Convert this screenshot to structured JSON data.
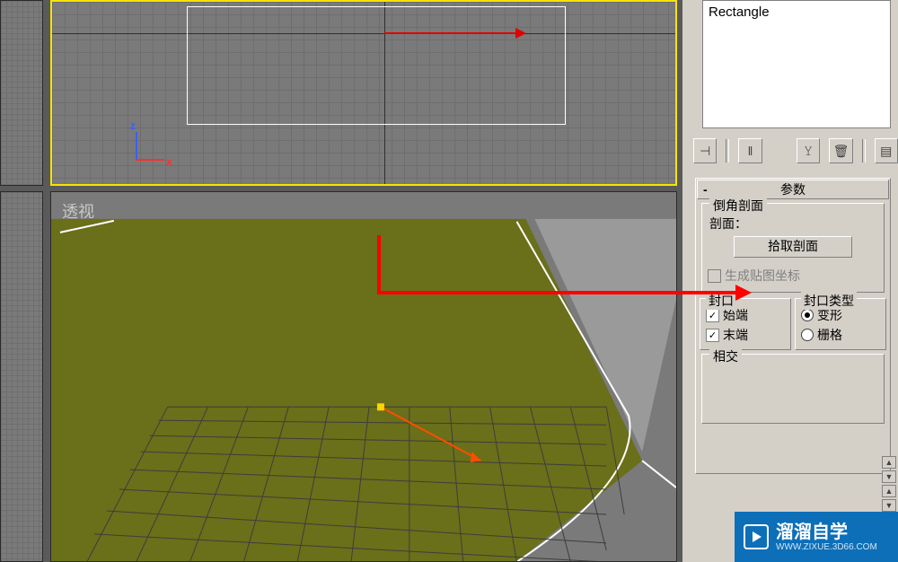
{
  "modifier_stack": {
    "item": "Rectangle"
  },
  "viewport": {
    "perspective_label": "透视",
    "axis_x": "x",
    "axis_z": "z"
  },
  "toolbar": {
    "pin": "⊣",
    "prev": "‖",
    "config": "𝚈",
    "delete": "🗑",
    "next": "▤"
  },
  "rollout": {
    "title": "参数",
    "collapse": "-",
    "bevel_profile_group": "倒角剖面",
    "profile_label": "剖面：",
    "pick_profile": "拾取剖面",
    "gen_uv": "生成贴图坐标",
    "cap_group": "封口",
    "cap_start": "始端",
    "cap_end": "末端",
    "cap_type_group": "封口类型",
    "cap_type_morph": "变形",
    "cap_type_grid": "栅格",
    "intersect_group": "相交"
  },
  "watermark": {
    "brand": "溜溜自学",
    "url": "WWW.ZIXUE.3D66.COM"
  }
}
